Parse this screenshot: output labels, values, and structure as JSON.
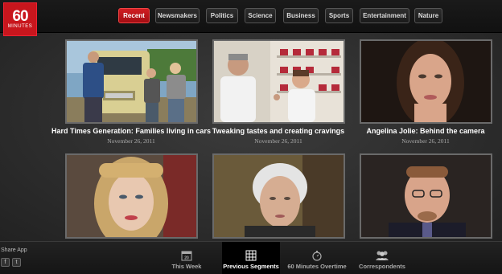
{
  "logo": {
    "number": "60",
    "word": "MINUTES"
  },
  "nav": {
    "items": [
      {
        "label": "Recent",
        "active": true
      },
      {
        "label": "Newsmakers",
        "active": false
      },
      {
        "label": "Politics",
        "active": false
      },
      {
        "label": "Science",
        "active": false
      },
      {
        "label": "Business",
        "active": false
      },
      {
        "label": "Sports",
        "active": false
      },
      {
        "label": "Entertainment",
        "active": false
      },
      {
        "label": "Nature",
        "active": false
      }
    ]
  },
  "segments": [
    {
      "title": "Hard Times Generation: Families living in cars",
      "date": "November 26, 2011"
    },
    {
      "title": "Tweaking tastes and creating cravings",
      "date": "November 26, 2011"
    },
    {
      "title": "Angelina Jolie: Behind the camera",
      "date": "November 26, 2011"
    },
    {
      "title": "",
      "date": ""
    },
    {
      "title": "",
      "date": ""
    },
    {
      "title": "",
      "date": ""
    }
  ],
  "share": {
    "label": "Share App",
    "facebook": "f",
    "twitter": "t"
  },
  "bottom_nav": [
    {
      "label": "This Week",
      "icon": "calendar-icon",
      "day": "20",
      "active": false
    },
    {
      "label": "Previous Segments",
      "icon": "grid-icon",
      "active": true
    },
    {
      "label": "60 Minutes Overtime",
      "icon": "stopwatch-icon",
      "active": false
    },
    {
      "label": "Correspondents",
      "icon": "people-icon",
      "active": false
    }
  ],
  "colors": {
    "brand_red": "#c8161d",
    "background": "#2b2b2b",
    "thumb_border": "#6a6a6a"
  }
}
